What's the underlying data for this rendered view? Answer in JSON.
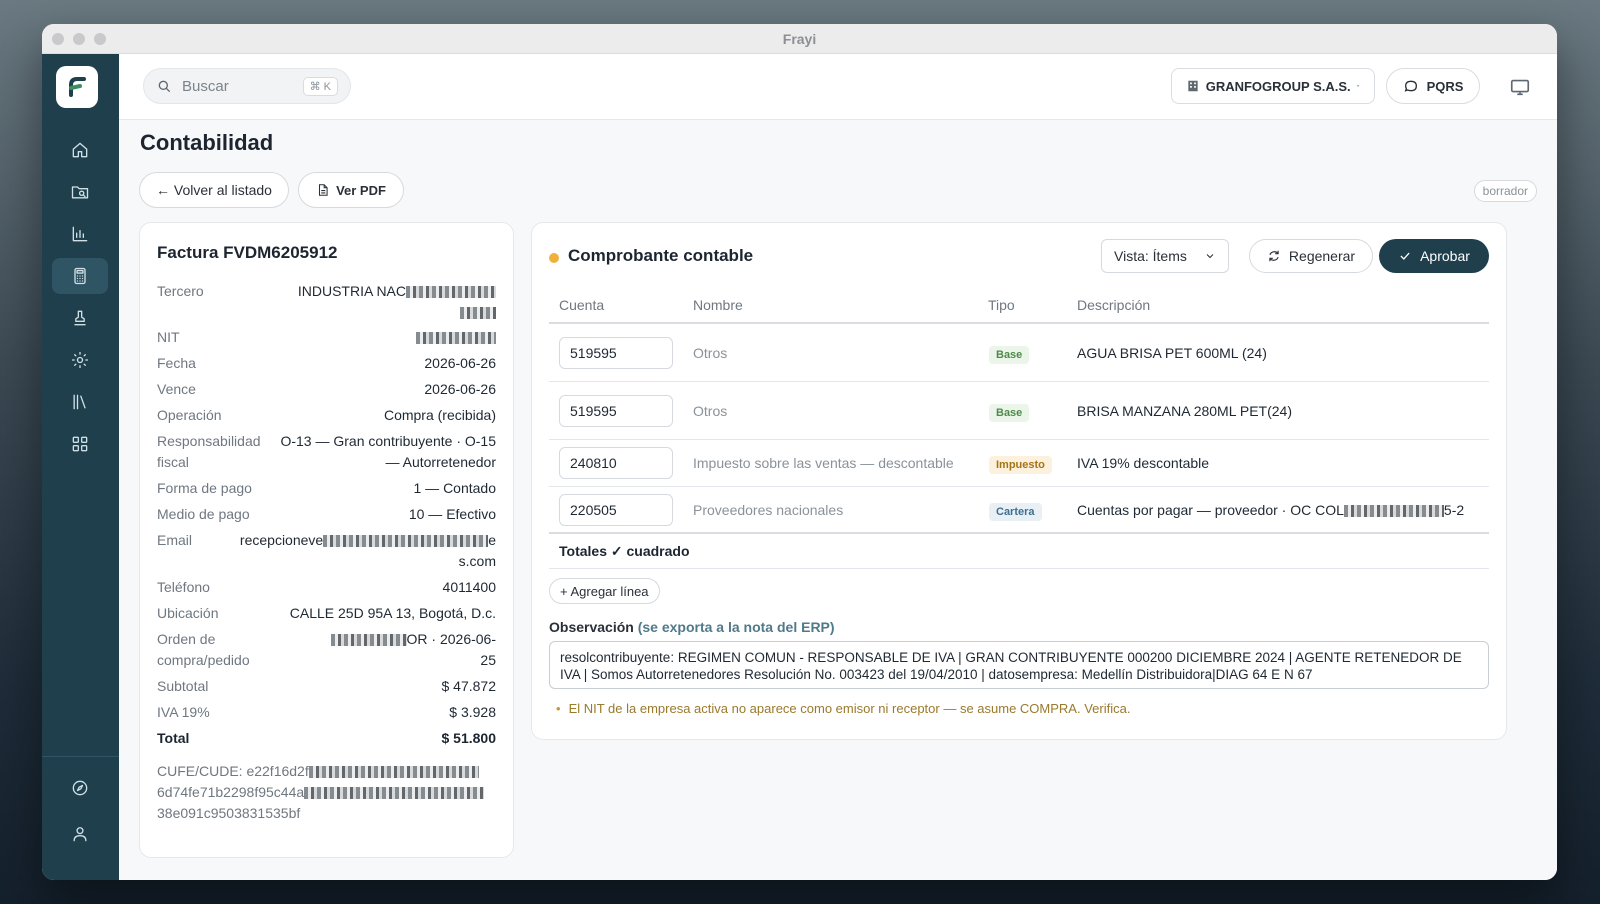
{
  "window": {
    "title": "Frayi"
  },
  "search": {
    "placeholder": "Buscar",
    "shortcut": "⌘ K"
  },
  "header": {
    "company": "GRANFOGROUP S.A.S.",
    "pqrs": "PQRS"
  },
  "page": {
    "title": "Contabilidad",
    "back_label": "← Volver al listado",
    "pdf_label": "Ver PDF",
    "status": "borrador"
  },
  "invoice": {
    "title": "Factura FVDM6205912",
    "fields": {
      "tercero": {
        "label": "Tercero",
        "value": "INDUSTRIA NAC"
      },
      "nit": {
        "label": "NIT",
        "value": ""
      },
      "fecha": {
        "label": "Fecha",
        "value": "2026-06-26"
      },
      "vence": {
        "label": "Vence",
        "value": "2026-06-26"
      },
      "operacion": {
        "label": "Operación",
        "value": "Compra (recibida)"
      },
      "responsabilidad": {
        "label": "Responsabilidad fiscal",
        "value": "O-13 — Gran contribuyente · O-15 — Autorretenedor"
      },
      "forma_pago": {
        "label": "Forma de pago",
        "value": "1 — Contado"
      },
      "medio_pago": {
        "label": "Medio de pago",
        "value": "10 — Efectivo"
      },
      "email": {
        "label": "Email",
        "value_start": "recepcioneve",
        "value_end": "e",
        "value_line2": "s.com"
      },
      "telefono": {
        "label": "Teléfono",
        "value": "4011400"
      },
      "ubicacion": {
        "label": "Ubicación",
        "value": "CALLE 25D 95A 13, Bogotá, D.c."
      },
      "orden": {
        "label": "Orden de compra/pedido",
        "value": "OR · 2026-06-25"
      },
      "subtotal": {
        "label": "Subtotal",
        "value": "$ 47.872"
      },
      "iva": {
        "label": "IVA 19%",
        "value": "$ 3.928"
      },
      "total": {
        "label": "Total",
        "value": "$ 51.800"
      }
    },
    "cufe": {
      "line1": "CUFE/CUDE: e22f16d2f",
      "line2": "6d74fe71b2298f95c44a",
      "line3": "38e091c9503831535bf"
    }
  },
  "voucher": {
    "title": "Comprobante contable",
    "view_select": "Vista: Ítems",
    "regenerate_label": "Regenerar",
    "approve_label": "Aprobar",
    "columns": {
      "cuenta": "Cuenta",
      "nombre": "Nombre",
      "tipo": "Tipo",
      "descripcion": "Descripción"
    },
    "rows": [
      {
        "cuenta": "519595",
        "nombre": "Otros",
        "tipo": "Base",
        "descripcion": "AGUA BRISA PET 600ML (24)"
      },
      {
        "cuenta": "519595",
        "nombre": "Otros",
        "tipo": "Base",
        "descripcion": "BRISA MANZANA 280ML PET(24)"
      },
      {
        "cuenta": "240810",
        "nombre": "Impuesto sobre las ventas — descontable",
        "tipo": "Impuesto",
        "descripcion": "IVA 19% descontable"
      },
      {
        "cuenta": "220505",
        "nombre": "Proveedores nacionales",
        "tipo": "Cartera",
        "descripcion": "Cuentas por pagar — proveedor · OC COL",
        "descripcion_end": "5-2"
      }
    ],
    "totals": "Totales ✓ cuadrado",
    "add_line": "+ Agregar línea",
    "observation_label": "Observación",
    "observation_note": "(se exporta a la nota del ERP)",
    "observation_text": "resolcontribuyente: REGIMEN COMUN - RESPONSABLE DE IVA | GRAN CONTRIBUYENTE 000200 DICIEMBRE 2024 | AGENTE RETENEDOR DE IVA | Somos Autorretenedores Resolución No. 003423 del 19/04/2010 | datosempresa: Medellín Distribuidora|DIAG 64 E N 67",
    "warning": "El NIT de la empresa activa no aparece como emisor ni receptor — se asume COMPRA. Verifica."
  }
}
